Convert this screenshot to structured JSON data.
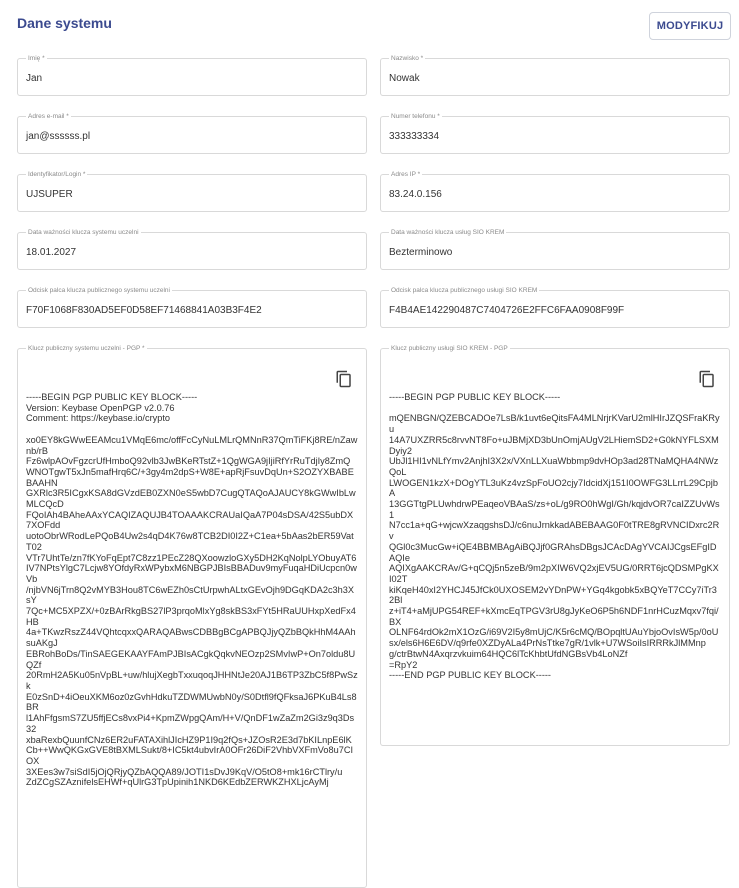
{
  "header": {
    "title": "Dane systemu",
    "modify_label": "MODYFIKUJ"
  },
  "fields": {
    "first_name": {
      "label": "Imię *",
      "value": "Jan"
    },
    "last_name": {
      "label": "Nazwisko *",
      "value": "Nowak"
    },
    "email": {
      "label": "Adres e-mail *",
      "value": "jan@ssssss.pl"
    },
    "phone": {
      "label": "Numer telefonu *",
      "value": "333333334"
    },
    "login": {
      "label": "Identyfikator/Login *",
      "value": "UJSUPER"
    },
    "ip": {
      "label": "Adres IP *",
      "value": "83.24.0.156"
    },
    "key_expiry_system": {
      "label": "Data ważności klucza systemu uczelni",
      "value": "18.01.2027"
    },
    "key_expiry_sio": {
      "label": "Data ważności klucza usług SIO KREM",
      "value": "Bezterminowo"
    },
    "fingerprint_system": {
      "label": "Odcisk palca klucza publicznego systemu uczelni",
      "value": "F70F1068F830AD5EF0D58EF71468841A03B3F4E2"
    },
    "fingerprint_sio": {
      "label": "Odcisk palca klucza publicznego usługi SIO KREM",
      "value": "F4B4AE142290487C7404726E2FFC6FAA0908F99F"
    }
  },
  "keys": {
    "system": {
      "label": "Klucz publiczny systemu uczelni - PGP *",
      "copy_icon": "copy-icon",
      "text": "-----BEGIN PGP PUBLIC KEY BLOCK-----\nVersion: Keybase OpenPGP v2.0.76\nComment: https://keybase.io/crypto\n\nxo0EY8kGWwEEAMcu1VMqE6mc/offFcCyNuLMLrQMNnR37QmTiFKj8RE/nZawnb/rB\nFz6wlpAOvFgzcrUfHmboQ92vlb3JwBKeRTstZ+1QgWGA9jIjiRfYrRuTdjIy8ZmQ\nWNOTgwT5xJn5mafHrq6C/+3gy4m2dpS+W8E+apRjFsuvDqUn+S2OZYXBABEBAAHN\nGXRlc3R5ICgxKSA8dGVzdEB0ZXN0eS5wbD7CugQTAQoAJAUCY8kGWwIbLwMLCQcD\nFQoIAh4BAheAAxYCAQIZAQUJB4TOAAAKCRAUaIQaA7P04sDSA/42S5ubDX7XOFdd\nuotoObrWRodLePQoB4Uw2s4qD4K76w8TCB2DI0I2Z+C1ea+5bAas2bER59Vat T02\nVTr7UhtTe/zn7fKYoFqEpt7C8zz1PEcZ28QXoowzloGXy5DH2KqNolpLYObuyAT6\nIV7NPtsYlgC7Lcjw8YOfdyRxWPybxM6NBGPJBIsBBADuv9myFuqaHDiUcpcn0wVb\n/njbVN6jTrn8Q2vMYB3Hou8TC6wEZh0sCtUrpwhALtxGEvOjh9DGqKDA2c3h3XsY\n7Qc+MC5XPZX/+0zBArRkgBS27lP3prqoMlxYg8skBS3xFYt5HRaUUHxpXedFx4HB\n4a+TKwzRszZ44VQhtcqxxQARAQABwsCDBBgBCgAPBQJjyQZbBQkHhM4AAhsuAKgJ\nEBRohBoDs/TinSAEGEKAAYFAmPJBIsACgkQqkvNEOzp2SMvIwP+On7oldu8UQZf\n20RmH2A5Ku05nVpBL+uw/hlujXegbTxxuqoqJHHNtJe20AJ1B6TP3ZbC5f8PwSzk\nE0zSnD+4iOeuXKM6oz0zGvhHdkuTZDWMUwbN0y/S0Dtfl9fQFksaJ6PKuB4Ls8BR\nl1AhFfgsmS7ZU5ffjECs8vxPi4+KpmZWpgQAm/H+V/QnDF1wZaZm2Gi3z9q3Ds32\nxbaRexbQuunfCNz6ER2uFATAXihlJIcHZ9P1I9q2fQs+JZOsR2E3d7bKILnpE6lK\nCb++WwQKGxGVE8tBXMLSukt/8+IC5kt4ubvIrA0OFr26DiF2VhbVXFmVo8u7CIOX\n3XEes3w7siSdI5jOjQRjyQZbAQQA89/JOTI1sDvJ9KqV/O5tO8+mk16rCTlry/u\nZdZCgSZAznifelsEHWf+qUlrG3TpUpinih1NKD6KEdbZERWKZHXLjcAyMj"
    },
    "sio": {
      "label": "Klucz publiczny usługi SIO KREM - PGP",
      "copy_icon": "copy-icon",
      "text": "-----BEGIN PGP PUBLIC KEY BLOCK-----\n\nmQENBGN/QZEBCADOe7LsB/k1uvt6eQitsFA4MLNrjrKVarU2mlHIrJZQSFraKRyu\n14A7UXZRR5c8rvvNT8Fo+uJBMjXD3bUnOmjAUgV2LHiemSD2+G0kNYFLSXMDyiy2\nUbJl1HI1vNLfYmv2AnjhI3X2x/VXnLLXuaWbbmp9dvHOp3ad28TNaMQHA4NWzQoL\nLWOGEN1kzX+DOgYTL3uKz4vzSpFoUO2cjy7IdcidXj151I0OWFG3LLrrL29CpjbA\n13GGTtgPLUwhdrwPEaqeoVBAaS/zs+oL/g9RO0hWgI/Gh/kqjdvOR7caIZZUvWs1\nN7cc1a+qG+wjcwXzaqgshsDJ/c6nuJrnkkadABEBAAG0F0tTRE8gRVNCIDxrc2Rv\nQGl0c3MucGw+iQE4BBMBAgAiBQJjf0GRAhsDBgsJCAcDAgYVCAIJCgsEFgIDAQIe\nAQIXgAAKCRAv/G+qCQj5n5zeB/9m2pXIW6VQ2xjEV5UG/0RRT6jcQDSMPgKXI02T\nkiKqeH40xI2YHCJ45JfCk0UXOSEM2vYDnPW+YGq4kgobk5xBQYeT7CCy7iTr32Bl\nz+iT4+aMjUPG54REF+kXmcEqTPGV3rU8gJyKeO6P5h6NDF1nrHCuzMqxv7fqi/BX\nOLNF64rdOk2mX1OzG/i69V2I5y8mUjC/K5r6cMQ/BOpqltUAuYbjoOvIsW5p/0oU\nsx/els6H6E6DV/q9rfe0XZDyALa4PrNsTtke7gR/1vlk+U7WSoiIsIRRRkJlMMnp\ng/ctrBtwN4Axqrzvkuim64HQC6lTcKhbtUfdNGBsVb4LoNZf\n=RpY2\n-----END PGP PUBLIC KEY BLOCK-----"
    }
  }
}
